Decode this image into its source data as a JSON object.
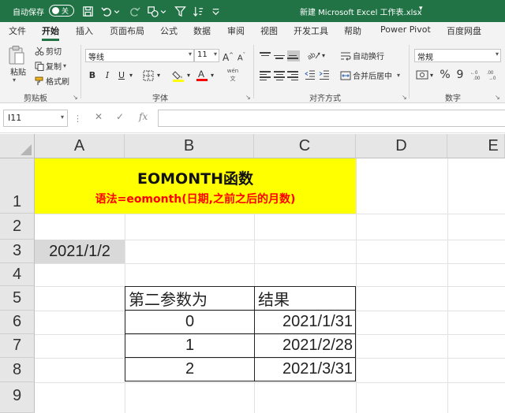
{
  "titlebar": {
    "autosave_label": "自动保存",
    "autosave_state": "关",
    "filename": "新建 Microsoft Excel 工作表.xlsx",
    "caret": "▾"
  },
  "tabs": [
    "文件",
    "开始",
    "插入",
    "页面布局",
    "公式",
    "数据",
    "审阅",
    "视图",
    "开发工具",
    "帮助",
    "Power Pivot",
    "百度网盘"
  ],
  "ribbon": {
    "clipboard": {
      "paste": "粘贴",
      "cut": "剪切",
      "copy": "复制",
      "format_painter": "格式刷",
      "group": "剪贴板"
    },
    "font": {
      "name": "等线",
      "size": "11",
      "bold": "B",
      "italic": "I",
      "underline": "U",
      "group": "字体",
      "grow": "A",
      "shrink": "A",
      "wen": "wén"
    },
    "alignment": {
      "wrap_text": "自动换行",
      "merge_center": "合并后居中",
      "group": "对齐方式"
    },
    "number": {
      "format": "常规",
      "percent": "%",
      "comma": "9",
      "group": "数字"
    }
  },
  "formula_bar": {
    "cell_ref": "I11",
    "fx": "fx",
    "cancel": "✕",
    "enter": "✓",
    "value": ""
  },
  "grid": {
    "columns": [
      "A",
      "B",
      "C",
      "D",
      "E"
    ],
    "rows": [
      "1",
      "2",
      "3",
      "4",
      "5",
      "6",
      "7",
      "8",
      "9"
    ],
    "title": "EOMONTH函数",
    "syntax": "语法=eomonth(日期,之前之后的月数)",
    "a3_value": "2021/1/2",
    "table": {
      "headers": [
        "第二参数为",
        "结果"
      ],
      "rows": [
        [
          "0",
          "2021/1/31"
        ],
        [
          "1",
          "2021/2/28"
        ],
        [
          "2",
          "2021/3/31"
        ]
      ]
    }
  },
  "colors": {
    "brand": "#217346",
    "highlight": "#ffff00",
    "syntax_text": "#ff0000",
    "selected_cell": "#d9d9d9"
  }
}
